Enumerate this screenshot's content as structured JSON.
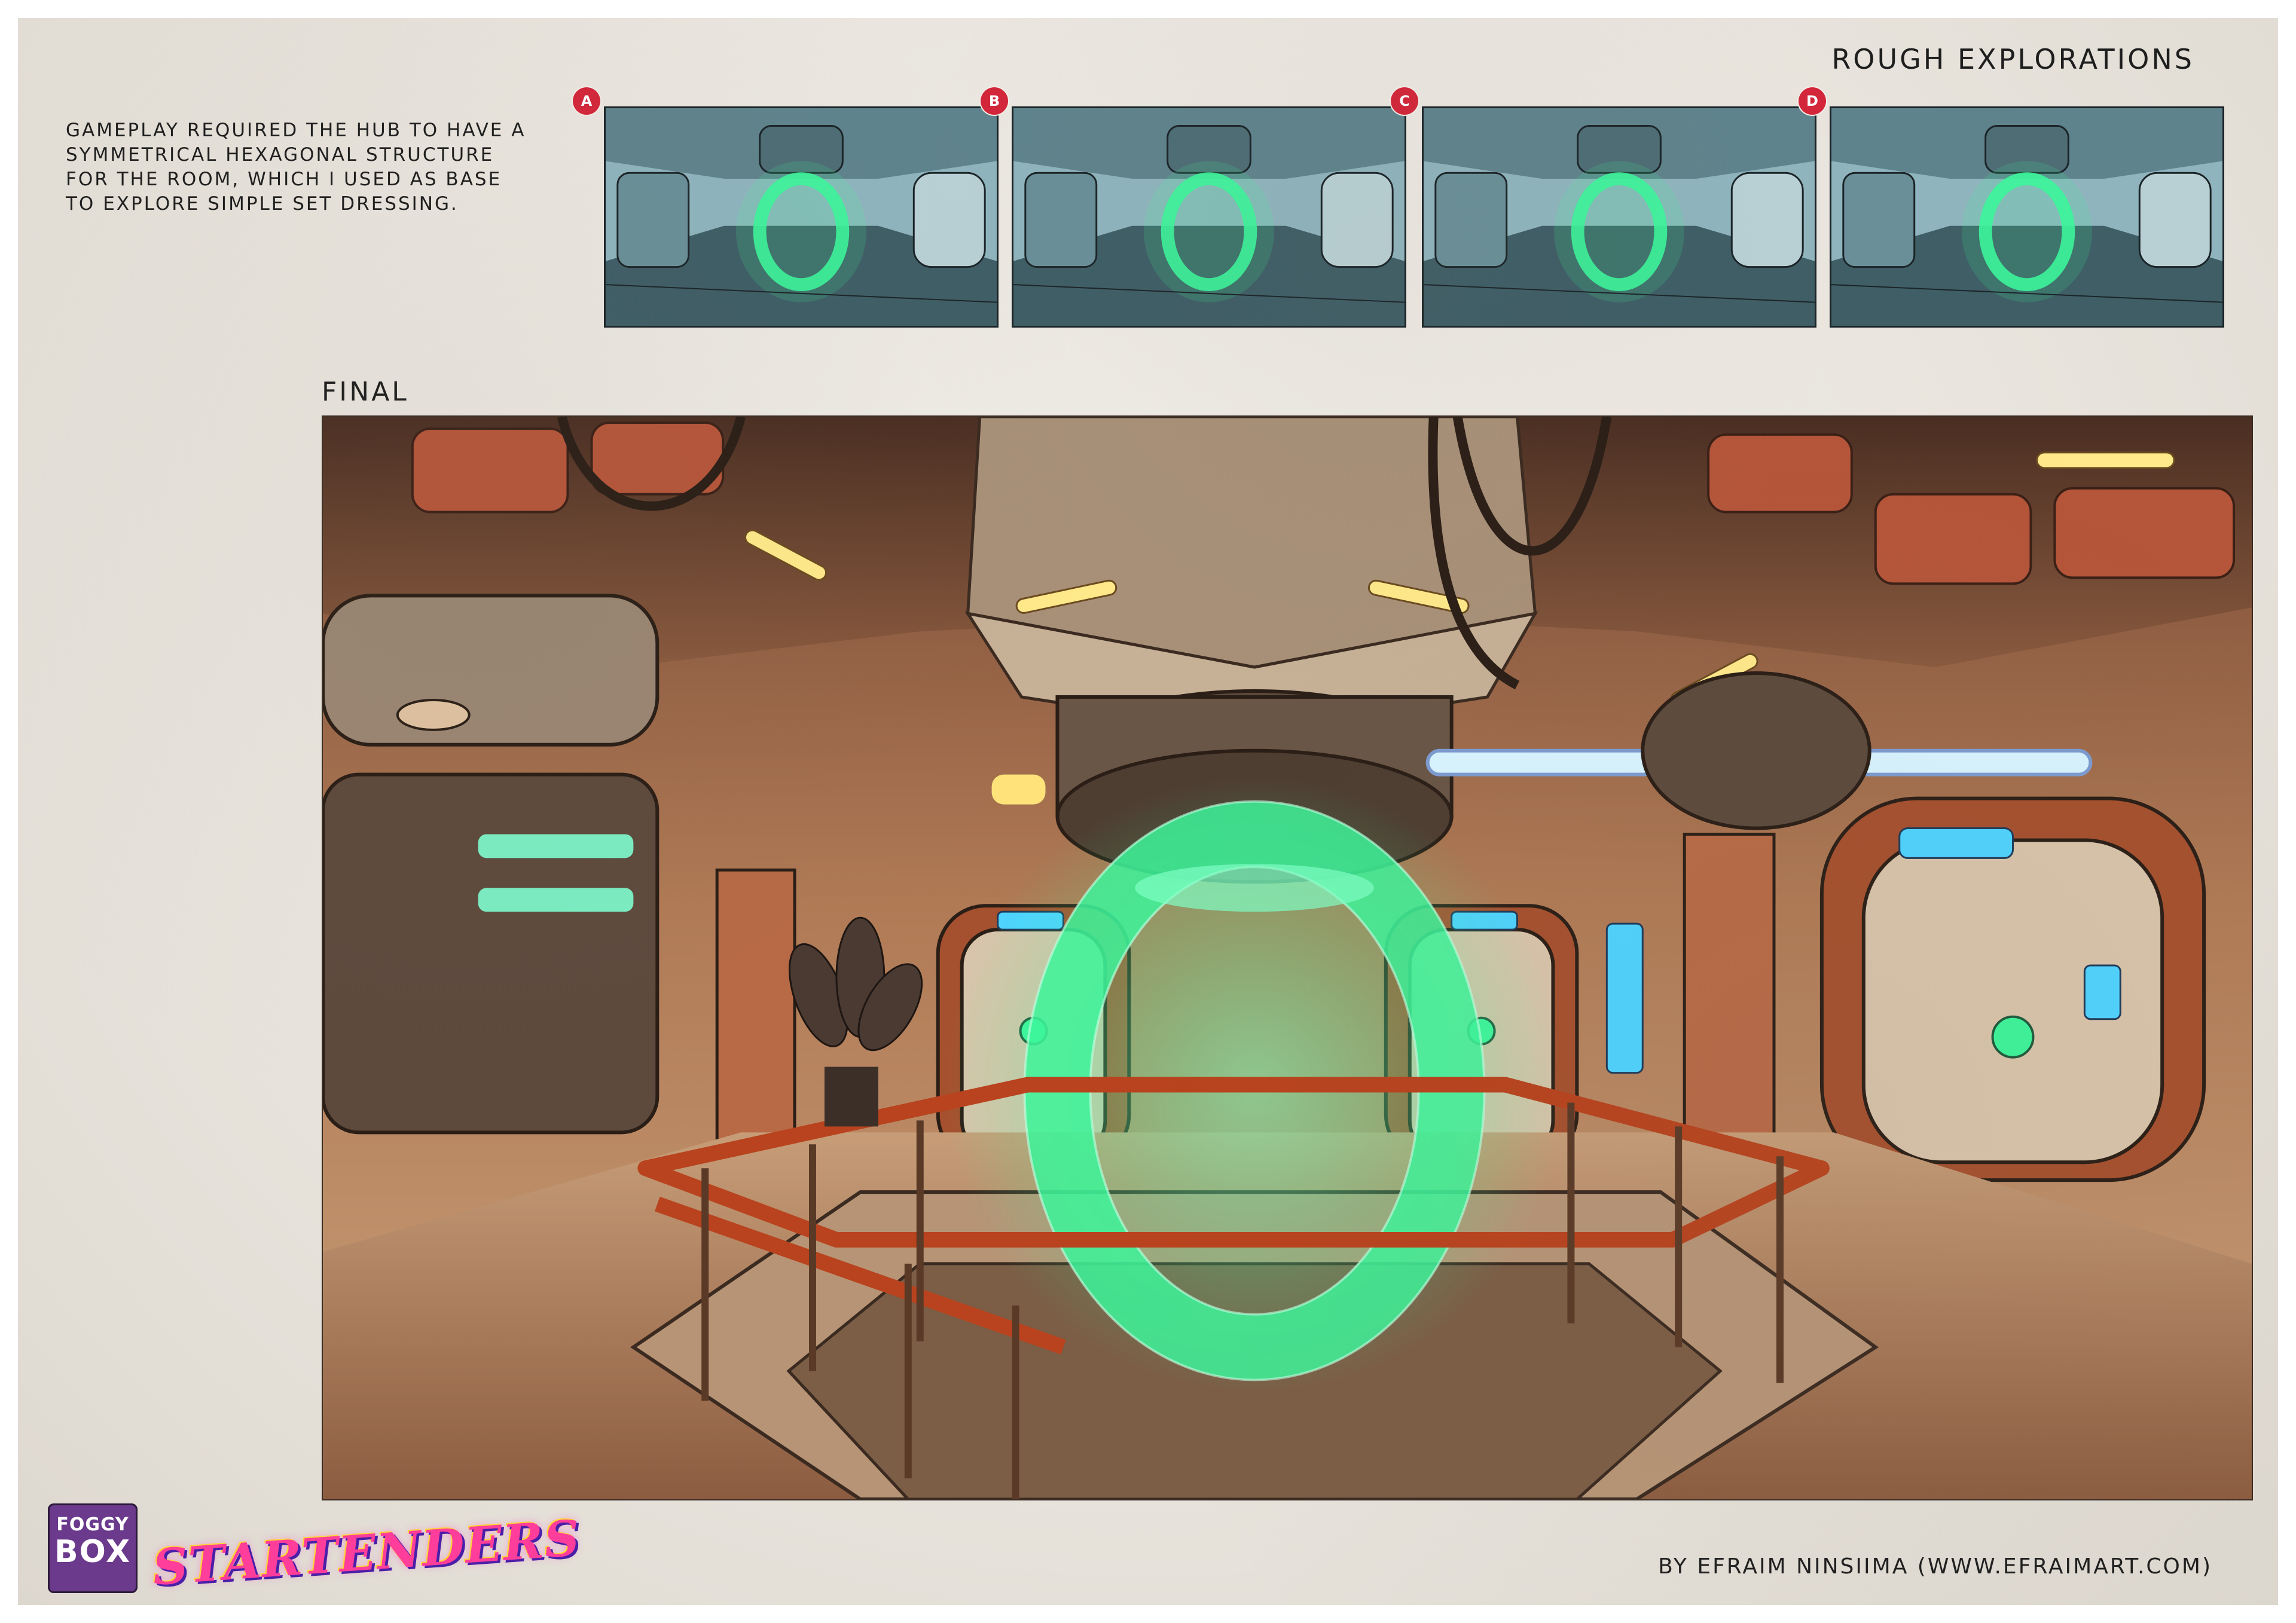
{
  "header": {
    "rough_title": "ROUGH EXPLORATIONS"
  },
  "description": "GAMEPLAY REQUIRED THE HUB TO HAVE A SYMMETRICAL HEXAGONAL STRUCTURE FOR THE ROOM, WHICH I USED AS BASE TO EXPLORE SIMPLE SET DRESSING.",
  "thumbnails": [
    {
      "label": "A"
    },
    {
      "label": "B"
    },
    {
      "label": "C"
    },
    {
      "label": "D"
    }
  ],
  "final_title": "FINAL",
  "credit": "BY EFRAIM NINSIIMA (WWW.EFRAIMART.COM)",
  "logos": {
    "foggy_box": {
      "line1": "FOGGY",
      "line2": "BOX"
    },
    "game_title": "STARTENDERS"
  },
  "colors": {
    "badge_red": "#d3263a",
    "portal_green": "#3df59a",
    "sketch_teal": "#8fb4bd",
    "final_wall_orange": "#b8653c"
  }
}
